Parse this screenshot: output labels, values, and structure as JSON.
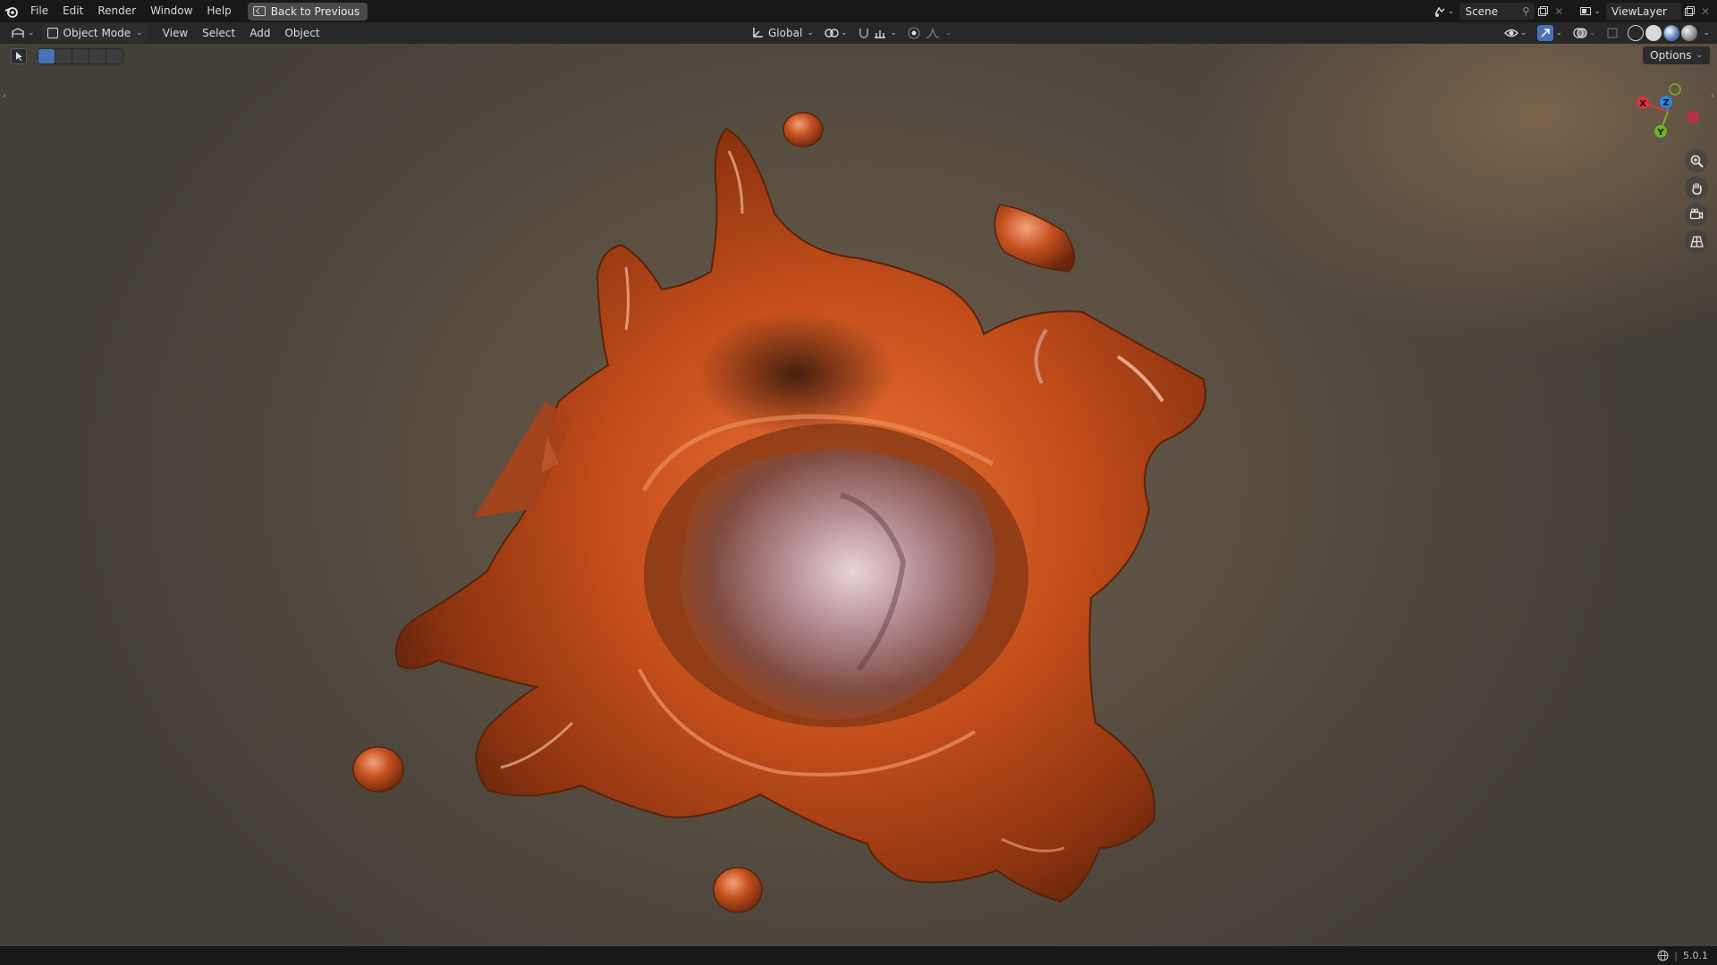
{
  "topbar": {
    "menus": [
      "File",
      "Edit",
      "Render",
      "Window",
      "Help"
    ],
    "back_label": "Back to Previous",
    "scene_name": "Scene",
    "view_layer": "ViewLayer"
  },
  "viewport_header": {
    "mode": "Object Mode",
    "menus": [
      "View",
      "Select",
      "Add",
      "Object"
    ],
    "orientation": "Global"
  },
  "viewport": {
    "options_label": "Options",
    "gizmo_axes": [
      "X",
      "Y",
      "Z"
    ],
    "colors": {
      "x_axis": "#e0313b",
      "y_axis": "#6fb322",
      "z_axis": "#2e85e6",
      "accent": "#4772b3",
      "liquid": "#c9521d"
    }
  },
  "statusbar": {
    "version": "5.0.1"
  }
}
